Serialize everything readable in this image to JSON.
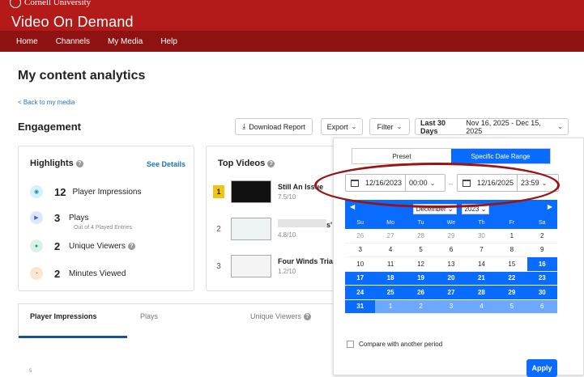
{
  "header": {
    "university": "Cornell University",
    "site_title": "Video On Demand"
  },
  "nav": {
    "items": [
      "Home",
      "Channels",
      "My Media",
      "Help"
    ]
  },
  "page": {
    "title": "My content analytics",
    "back_link": "< Back to my media",
    "section": "Engagement"
  },
  "toolbar": {
    "download_label": "Download Report",
    "export_label": "Export",
    "filter_label": "Filter",
    "range_label": "Last 30 Days",
    "range_value": "Nov 16, 2025 - Dec 15, 2025"
  },
  "highlights": {
    "title": "Highlights",
    "see_details": "See Details",
    "items": [
      {
        "value": "12",
        "label": "Player Impressions",
        "sub": ""
      },
      {
        "value": "3",
        "label": "Plays",
        "sub": "Out of 4 Played Entries"
      },
      {
        "value": "2",
        "label": "Unique Viewers",
        "sub": ""
      },
      {
        "value": "2",
        "label": "Minutes Viewed",
        "sub": ""
      }
    ]
  },
  "top_videos": {
    "title": "Top Videos",
    "items": [
      {
        "rank": "1",
        "title": "Still An Issue",
        "score": "7.5/10"
      },
      {
        "rank": "2",
        "title": "s'",
        "score": "4.8/10"
      },
      {
        "rank": "3",
        "title": "Four Winds Trial",
        "score": "1.2/10"
      }
    ]
  },
  "tabs": [
    "Player Impressions",
    "Plays",
    "Unique Viewers"
  ],
  "chart": {
    "y_tick": "5"
  },
  "date_picker": {
    "preset_label": "Preset",
    "specific_label": "Specific Date Range",
    "start_date": "12/16/2023",
    "start_time": "00:00",
    "end_date": "12/16/2025",
    "end_time": "23:59",
    "month": "December",
    "year": "2023",
    "weekdays": [
      "Su",
      "Mo",
      "Tu",
      "We",
      "Th",
      "Fr",
      "Sa"
    ],
    "days": [
      "26",
      "27",
      "28",
      "29",
      "30",
      "1",
      "2",
      "3",
      "4",
      "5",
      "6",
      "7",
      "8",
      "9",
      "10",
      "11",
      "12",
      "13",
      "14",
      "15",
      "16",
      "17",
      "18",
      "19",
      "20",
      "21",
      "22",
      "23",
      "24",
      "25",
      "26",
      "27",
      "28",
      "29",
      "30",
      "31",
      "1",
      "2",
      "3",
      "4",
      "5",
      "6"
    ],
    "compare_label": "Compare with another period",
    "apply_label": "Apply"
  }
}
